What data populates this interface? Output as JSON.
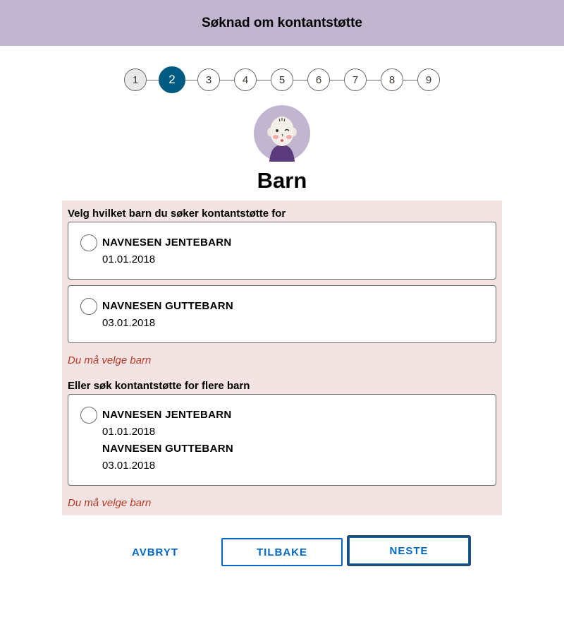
{
  "header": {
    "title": "Søknad om kontantstøtte"
  },
  "stepper": {
    "steps": [
      "1",
      "2",
      "3",
      "4",
      "5",
      "6",
      "7",
      "8",
      "9"
    ],
    "current": "2"
  },
  "page": {
    "title": "Barn"
  },
  "select_child": {
    "legend": "Velg hvilket barn du søker kontantstøtte for",
    "options": [
      {
        "name": "NAVNESEN JENTEBARN",
        "birthdate": "01.01.2018"
      },
      {
        "name": "NAVNESEN GUTTEBARN",
        "birthdate": "03.01.2018"
      }
    ],
    "error": "Du må velge barn"
  },
  "multiple_children": {
    "legend": "Eller søk kontantstøtte for flere barn",
    "option": {
      "children": [
        {
          "name": "NAVNESEN JENTEBARN",
          "birthdate": "01.01.2018"
        },
        {
          "name": "NAVNESEN GUTTEBARN",
          "birthdate": "03.01.2018"
        }
      ]
    },
    "error": "Du må velge barn"
  },
  "buttons": {
    "cancel": "AVBRYT",
    "back": "TILBAKE",
    "next": "NESTE"
  },
  "colors": {
    "header_bg": "#c1b5d0",
    "active_step": "#005b82",
    "error_panel": "#f3e3e3",
    "error_text": "#ba3a26",
    "link_blue": "#0067c5"
  },
  "icons": {
    "avatar": "baby-avatar-icon"
  }
}
